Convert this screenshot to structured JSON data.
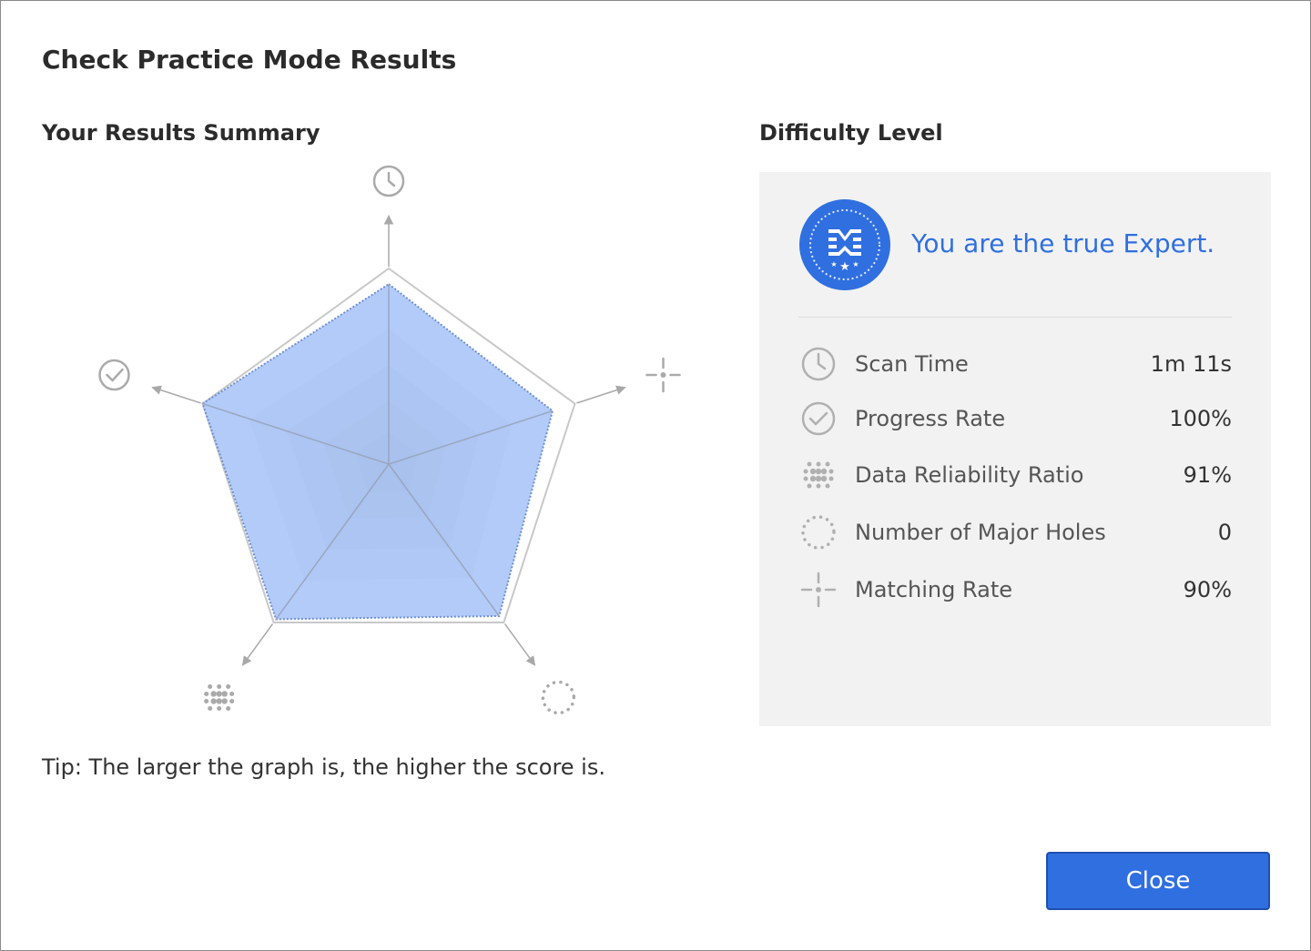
{
  "dialog": {
    "title": "Check Practice Mode Results",
    "summary_title": "Your Results Summary",
    "difficulty_title": "Difficulty Level",
    "tip": "Tip: The larger the graph is, the higher the score is.",
    "close_label": "Close"
  },
  "difficulty": {
    "badge_icon": "expert-medal-icon",
    "message": "You are the true Expert."
  },
  "metrics": [
    {
      "icon": "clock-icon",
      "label": "Scan Time",
      "value": "1m 11s"
    },
    {
      "icon": "check-circle-icon",
      "label": "Progress Rate",
      "value": "100%"
    },
    {
      "icon": "dot-grid-icon",
      "label": "Data Reliability Ratio",
      "value": "91%"
    },
    {
      "icon": "dotted-circle-icon",
      "label": "Number of Major Holes",
      "value": "0"
    },
    {
      "icon": "crosshair-icon",
      "label": "Matching Rate",
      "value": "90%"
    }
  ],
  "chart_data": {
    "type": "radar",
    "axes": [
      {
        "icon": "clock-icon",
        "metric": "Scan Time",
        "score": 0.92
      },
      {
        "icon": "crosshair-icon",
        "metric": "Matching Rate",
        "score": 0.88
      },
      {
        "icon": "dotted-circle-icon",
        "metric": "Number of Major Holes",
        "score": 0.96
      },
      {
        "icon": "dot-grid-icon",
        "metric": "Data Reliability Ratio",
        "score": 0.98
      },
      {
        "icon": "check-circle-icon",
        "metric": "Progress Rate",
        "score": 1.0
      }
    ],
    "range": [
      0,
      1
    ],
    "colors": {
      "fill": "#b3cbf8",
      "outline": "#6b8fd6",
      "axis": "#a8a8a8",
      "icon": "#aaaaaa"
    }
  },
  "colors": {
    "accent": "#2f6fe0",
    "panel": "#f2f2f2"
  }
}
